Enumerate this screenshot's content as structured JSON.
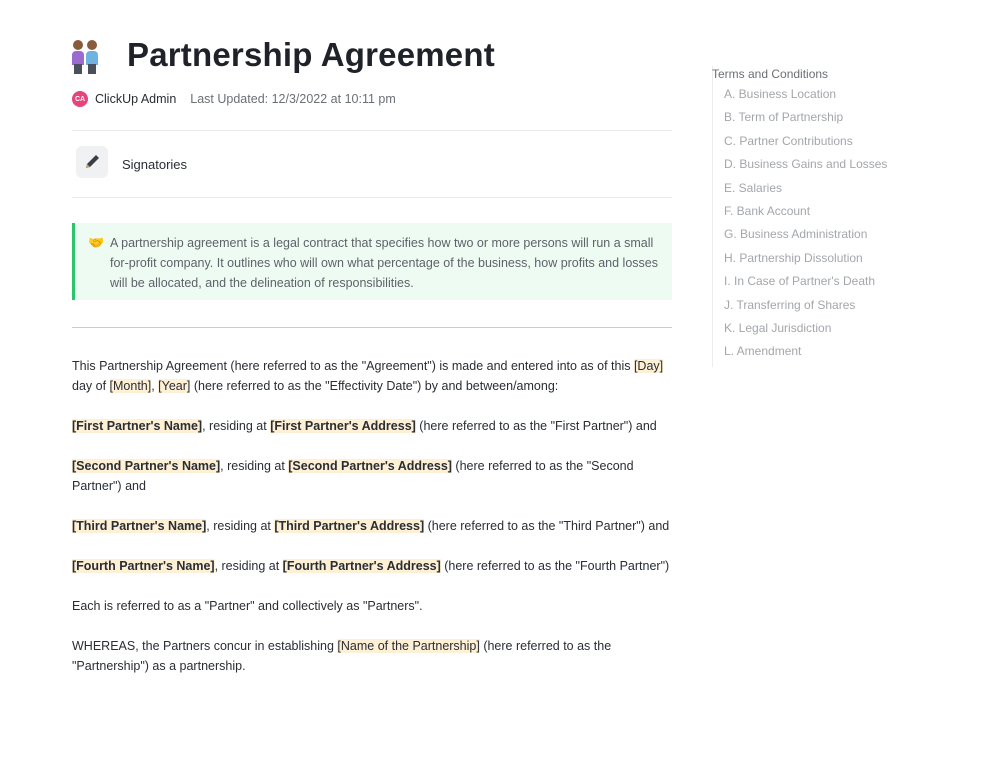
{
  "title": "Partnership Agreement",
  "title_icon": "two-people-emoji",
  "meta": {
    "avatar_initials": "CA",
    "author": "ClickUp Admin",
    "updated": "Last Updated: 12/3/2022 at 10:11 pm"
  },
  "signatories": {
    "label": "Signatories",
    "icon": "pen-icon"
  },
  "callout": {
    "emoji": "🤝",
    "text": "A partnership agreement is a legal contract that specifies how two or more persons will run a small for-profit company. It outlines who will own what percentage of the business, how profits and losses will be allocated, and the delineation of responsibilities."
  },
  "body": {
    "p1_a": "This Partnership Agreement (here referred to as the \"Agreement\") is made and entered into as of this ",
    "p1_day": "[Day]",
    "p1_b": " day of ",
    "p1_month": "[Month]",
    "p1_c": ", ",
    "p1_year": "[Year]",
    "p1_d": " (here referred to as the \"Effectivity Date\") by and between/among:",
    "partners": [
      {
        "name": "[First Partner's Name]",
        "mid": ", residing at ",
        "address": "[First Partner's Address]",
        "tail": " (here referred to as the \"First Partner\") and"
      },
      {
        "name": "[Second Partner's Name]",
        "mid": ", residing at ",
        "address": "[Second Partner's Address]",
        "tail": " (here referred to as the \"Second Partner\") and"
      },
      {
        "name": "[Third Partner's Name]",
        "mid": ", residing at ",
        "address": "[Third Partner's Address]",
        "tail": " (here referred to as the \"Third Partner\") and"
      },
      {
        "name": "[Fourth Partner's Name]",
        "mid": ", residing at ",
        "address": "[Fourth Partner's Address]",
        "tail": " (here referred to as the \"Fourth Partner\")"
      }
    ],
    "p_each": "Each is referred to as a \"Partner\" and collectively as \"Partners\".",
    "p_whereas_a": "WHEREAS, the Partners concur in establishing ",
    "p_whereas_name": "[Name of the Partnership]",
    "p_whereas_b": " (here referred to as the \"Partnership\") as a partnership."
  },
  "toc": {
    "title": "Terms and Conditions",
    "items": [
      "A. Business Location",
      "B. Term of Partnership",
      "C. Partner Contributions",
      "D. Business Gains and Losses",
      "E. Salaries",
      "F. Bank Account",
      "G. Business Administration",
      "H. Partnership Dissolution",
      "I. In Case of Partner's Death",
      "J. Transferring of Shares",
      "K. Legal Jurisdiction",
      "L. Amendment"
    ]
  }
}
